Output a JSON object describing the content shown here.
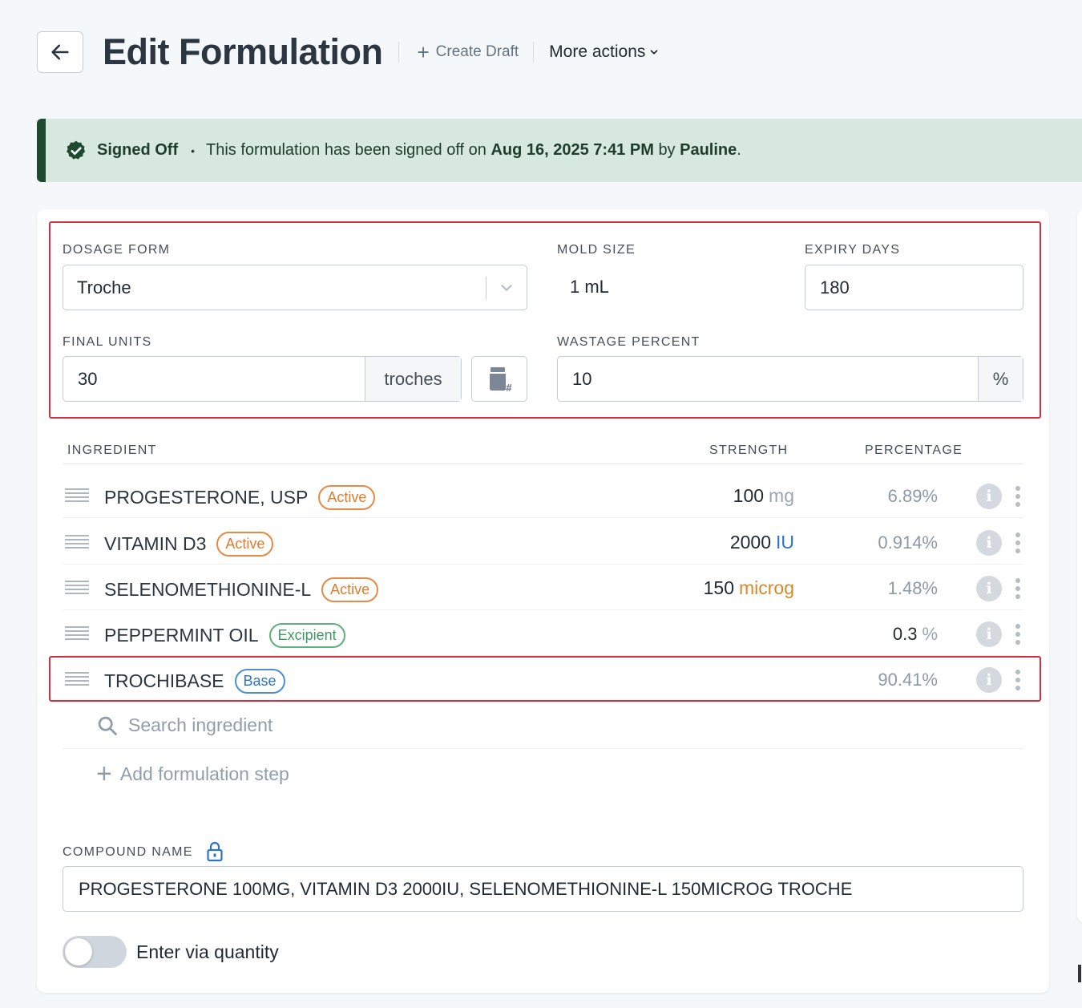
{
  "header": {
    "title": "Edit Formulation",
    "create_draft_label": "Create Draft",
    "more_actions_label": "More actions"
  },
  "banner": {
    "status": "Signed Off",
    "message_prefix": "This formulation has been signed off on",
    "date": "Aug 16, 2025 7:41 PM",
    "by_word": "by",
    "user": "Pauline",
    "end": "."
  },
  "form": {
    "dosage_form": {
      "label": "DOSAGE FORM",
      "value": "Troche"
    },
    "mold_size": {
      "label": "MOLD SIZE",
      "value": "1 mL"
    },
    "expiry_days": {
      "label": "EXPIRY DAYS",
      "value": "180"
    },
    "final_units": {
      "label": "FINAL UNITS",
      "value": "30",
      "unit": "troches"
    },
    "wastage_percent": {
      "label": "WASTAGE PERCENT",
      "value": "10",
      "unit": "%"
    }
  },
  "table": {
    "headers": {
      "ingredient": "INGREDIENT",
      "strength": "STRENGTH",
      "percentage": "PERCENTAGE"
    },
    "rows": [
      {
        "name": "PROGESTERONE, USP",
        "badge": "Active",
        "strength": "100",
        "unit": "mg",
        "percentage": "6.89%"
      },
      {
        "name": "VITAMIN D3",
        "badge": "Active",
        "strength": "2000",
        "unit": "IU",
        "percentage": "0.914%"
      },
      {
        "name": "SELENOMETHIONINE-L",
        "badge": "Active",
        "strength": "150",
        "unit": "microg",
        "percentage": "1.48%"
      },
      {
        "name": "PEPPERMINT OIL",
        "badge": "Excipient",
        "strength": "",
        "unit": "",
        "percentage": "0.3",
        "percentage_unit": "%"
      },
      {
        "name": "TROCHIBASE",
        "badge": "Base",
        "strength": "",
        "unit": "",
        "percentage": "90.41%"
      }
    ],
    "search_placeholder": "Search ingredient",
    "add_step_label": "Add formulation step"
  },
  "compound": {
    "label": "COMPOUND NAME",
    "value": "PROGESTERONE 100MG, VITAMIN D3 2000IU, SELENOMETHIONINE-L 150MICROG TROCHE"
  },
  "toggle": {
    "label": "Enter via quantity",
    "on": false
  },
  "colors": {
    "accent_green": "#1f4a32",
    "banner_bg": "#d7e8de",
    "highlight_red": "#d32f45",
    "active_orange": "#e07b2c",
    "excipient_green": "#3c9a5f",
    "base_blue": "#2f74c0"
  },
  "icons": [
    "back-arrow-icon",
    "plus-icon",
    "chevron-down-icon",
    "verified-badge-icon",
    "calculator-icon",
    "drag-handle-icon",
    "info-icon",
    "kebab-menu-icon",
    "search-icon",
    "lock-icon"
  ]
}
